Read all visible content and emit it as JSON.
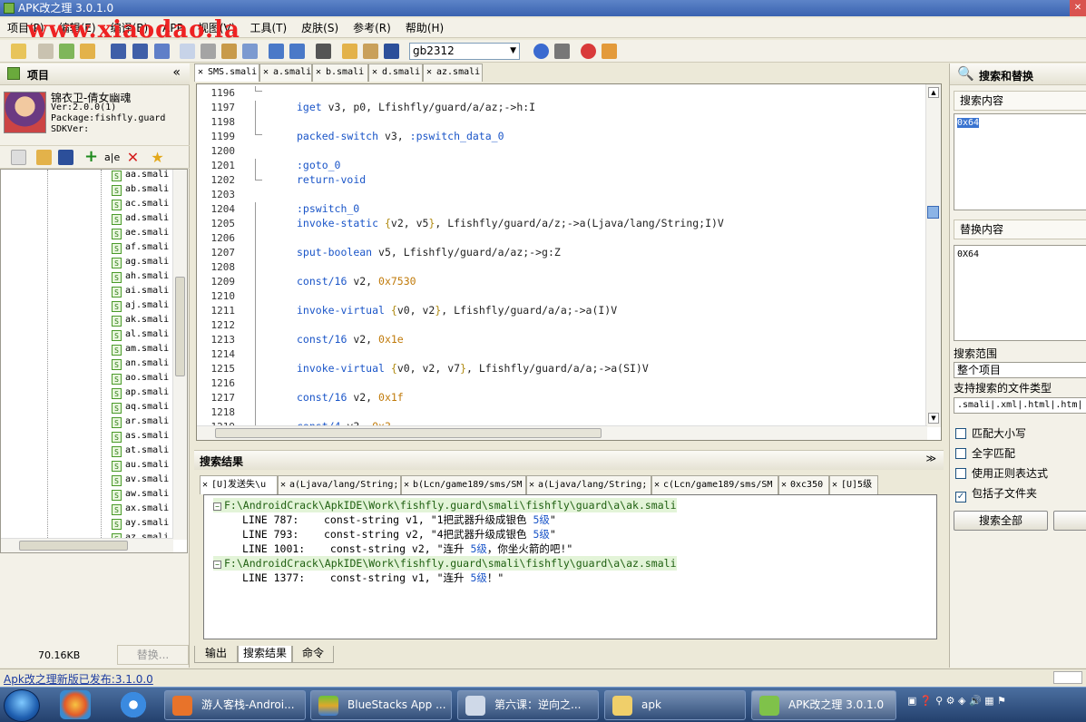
{
  "window": {
    "title": "APK改之理 3.0.1.0",
    "watermark": "www.xiaodao.la"
  },
  "menu": [
    "项目(P)",
    "编辑(E)",
    "编译(B)",
    "APP",
    "视图(V)",
    "工具(T)",
    "皮肤(S)",
    "参考(R)",
    "帮助(H)"
  ],
  "toolbar": {
    "encoding": "gb2312"
  },
  "project": {
    "title": "项目",
    "app_name": "锦衣卫-倩女幽魂",
    "version": "Ver:2.0.0(1)",
    "package": "Package:fishfly.guard",
    "sdk": "SDKVer:",
    "files": [
      "aa.smali",
      "ab.smali",
      "ac.smali",
      "ad.smali",
      "ae.smali",
      "af.smali",
      "ag.smali",
      "ah.smali",
      "ai.smali",
      "aj.smali",
      "ak.smali",
      "al.smali",
      "am.smali",
      "an.smali",
      "ao.smali",
      "ap.smali",
      "aq.smali",
      "ar.smali",
      "as.smali",
      "at.smali",
      "au.smali",
      "av.smali",
      "aw.smali",
      "ax.smali",
      "ay.smali",
      "az.smali"
    ],
    "size": "70.16KB",
    "replace_button": "替换..."
  },
  "editor_tabs": [
    "SMS.smali",
    "a.smali",
    "b.smali",
    "d.smali",
    "az.smali"
  ],
  "editor": {
    "lines": [
      {
        "n": "1196",
        "c": ""
      },
      {
        "n": "1197",
        "c": "iget v3, p0, Lfishfly/guard/a/az;->h:I"
      },
      {
        "n": "1198",
        "c": ""
      },
      {
        "n": "1199",
        "c": "packed-switch v3, :pswitch_data_0"
      },
      {
        "n": "1200",
        "c": ""
      },
      {
        "n": "1201",
        "c": ":goto_0"
      },
      {
        "n": "1202",
        "c": "return-void"
      },
      {
        "n": "1203",
        "c": ""
      },
      {
        "n": "1204",
        "c": ":pswitch_0"
      },
      {
        "n": "1205",
        "c": "invoke-static {v2, v5}, Lfishfly/guard/a/z;->a(Ljava/lang/String;I)V"
      },
      {
        "n": "1206",
        "c": ""
      },
      {
        "n": "1207",
        "c": "sput-boolean v5, Lfishfly/guard/a/az;->g:Z"
      },
      {
        "n": "1208",
        "c": ""
      },
      {
        "n": "1209",
        "c": "const/16 v2, 0x7530"
      },
      {
        "n": "1210",
        "c": ""
      },
      {
        "n": "1211",
        "c": "invoke-virtual {v0, v2}, Lfishfly/guard/a/a;->a(I)V"
      },
      {
        "n": "1212",
        "c": ""
      },
      {
        "n": "1213",
        "c": "const/16 v2, 0x1e"
      },
      {
        "n": "1214",
        "c": ""
      },
      {
        "n": "1215",
        "c": "invoke-virtual {v0, v2, v7}, Lfishfly/guard/a/a;->a(SI)V"
      },
      {
        "n": "1216",
        "c": ""
      },
      {
        "n": "1217",
        "c": "const/16 v2, 0x1f"
      },
      {
        "n": "1218",
        "c": ""
      },
      {
        "n": "1219",
        "c": "const/4 v3, 0x3"
      }
    ]
  },
  "results": {
    "title": "搜索结果",
    "tabs": [
      "[U]发送失\\u",
      "a(Ljava/lang/String;",
      "b(Lcn/game189/sms/SM",
      "a(Ljava/lang/String;",
      "c(Lcn/game189/sms/SM",
      "0xc350",
      "[U]5级"
    ],
    "rows": [
      {
        "type": "file",
        "text": "F:\\AndroidCrack\\ApkIDE\\Work\\fishfly.guard\\smali\\fishfly\\guard\\a\\ak.smali"
      },
      {
        "type": "line",
        "text": "LINE 787:    const-string v1, \"1把武器升级成银色 5级\""
      },
      {
        "type": "line",
        "text": "LINE 793:    const-string v2, \"4把武器升级成银色 5级\""
      },
      {
        "type": "line",
        "text": "LINE 1001:    const-string v2, \"连升 5级，你坐火箭的吧!\""
      },
      {
        "type": "file",
        "text": "F:\\AndroidCrack\\ApkIDE\\Work\\fishfly.guard\\smali\\fishfly\\guard\\a\\az.smali"
      },
      {
        "type": "line",
        "text": "LINE 1377:    const-string v1, \"连升 5级！\""
      }
    ],
    "bottom_tabs": [
      "输出",
      "搜索结果",
      "命令"
    ]
  },
  "search": {
    "title": "搜索和替换",
    "search_label": "搜索内容",
    "search_value": "0x64",
    "replace_label": "替换内容",
    "replace_value": "0X64",
    "scope_label": "搜索范围",
    "scope_value": "整个项目",
    "types_label": "支持搜索的文件类型",
    "types_value": ".smali|.xml|.html|.htm|",
    "options": [
      {
        "label": "匹配大小写",
        "checked": false
      },
      {
        "label": "全字匹配",
        "checked": false
      },
      {
        "label": "使用正则表达式",
        "checked": false
      },
      {
        "label": "包括子文件夹",
        "checked": true
      }
    ],
    "search_all": "搜索全部"
  },
  "status": {
    "update": "Apk改之理新版已发布:3.1.0.0"
  },
  "taskbar": {
    "buttons": [
      "游人客栈-Androi...",
      "BlueStacks App ...",
      "第六课：逆向之...",
      "apk",
      "APK改之理 3.0.1.0"
    ]
  }
}
